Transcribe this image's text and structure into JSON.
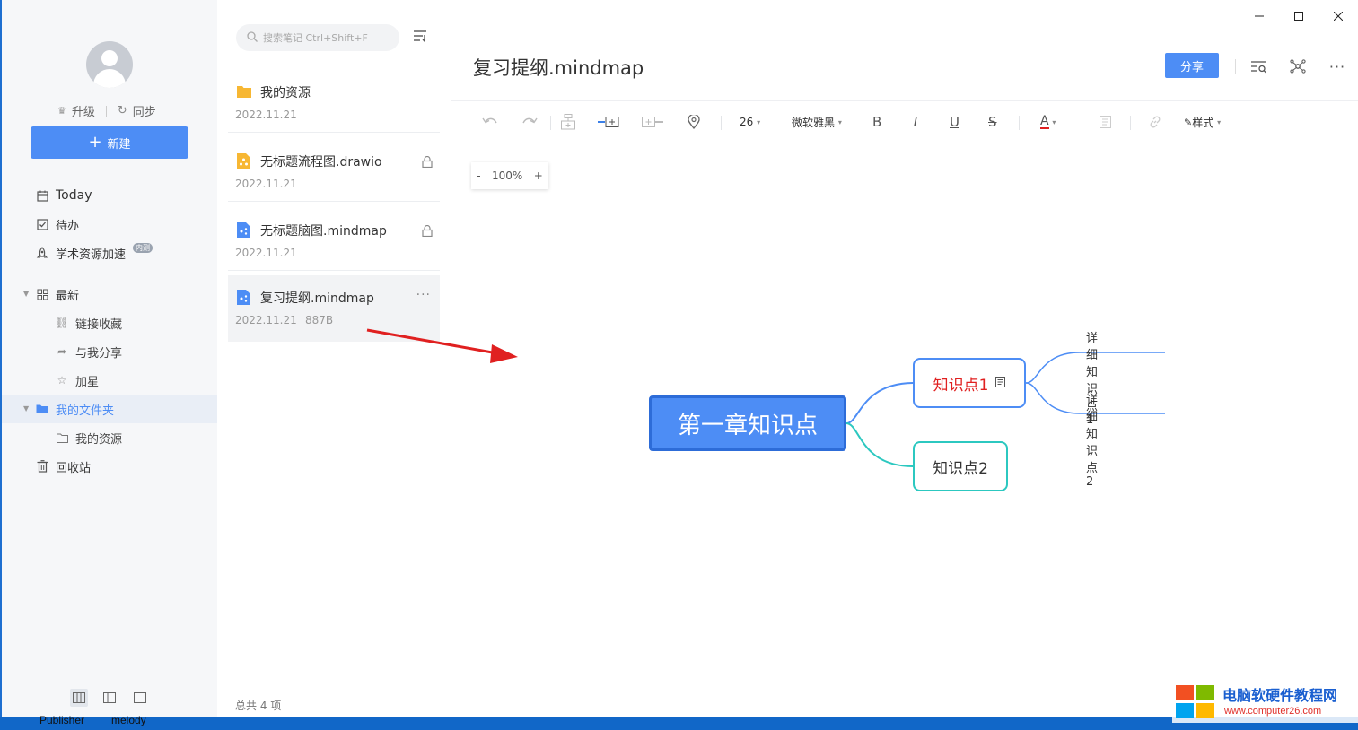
{
  "sidebar": {
    "upgrade_label": "升级",
    "sync_label": "同步",
    "new_label": "新建",
    "nav": {
      "today": "Today",
      "todo": "待办",
      "academic": "学术资源加速",
      "academic_badge": "内测",
      "recent": "最新",
      "link_collect": "链接收藏",
      "shared_with_me": "与我分享",
      "starred": "加星",
      "my_folder": "我的文件夹",
      "my_resources": "我的资源",
      "trash": "回收站"
    },
    "colors": {
      "accent": "#4d8df5"
    }
  },
  "notelist": {
    "search_placeholder": "搜索笔记 Ctrl+Shift+F",
    "items": [
      {
        "title": "我的资源",
        "date": "2022.11.21",
        "icon": "folder-icon"
      },
      {
        "title": "无标题流程图.drawio",
        "date": "2022.11.21",
        "icon": "drawio-icon",
        "locked": true
      },
      {
        "title": "无标题脑图.mindmap",
        "date": "2022.11.21",
        "icon": "mindmap-icon",
        "locked": true
      },
      {
        "title": "复习提纲.mindmap",
        "date": "2022.11.21",
        "size": "887B",
        "icon": "mindmap-icon",
        "selected": true
      }
    ],
    "footer": "总共 4 项"
  },
  "editor": {
    "title": "复习提纲.mindmap",
    "share_label": "分享",
    "toolbar": {
      "font_size": "26",
      "font_family": "微软雅黑",
      "bold": "B",
      "italic": "I",
      "underline": "U",
      "strike": "S",
      "font_color": "A",
      "style_label": "样式"
    },
    "zoom": {
      "minus": "-",
      "value": "100%",
      "plus": "+"
    }
  },
  "mindmap": {
    "root": "第一章知识点",
    "k1": "知识点1",
    "k2": "知识点2",
    "leaf1": "详细知识点1",
    "leaf2": "详细知识点2"
  },
  "taskbar": {
    "item1": "Publisher",
    "item2": "melody"
  },
  "watermark": {
    "title": "电脑软硬件教程网",
    "url": "www.computer26.com"
  }
}
